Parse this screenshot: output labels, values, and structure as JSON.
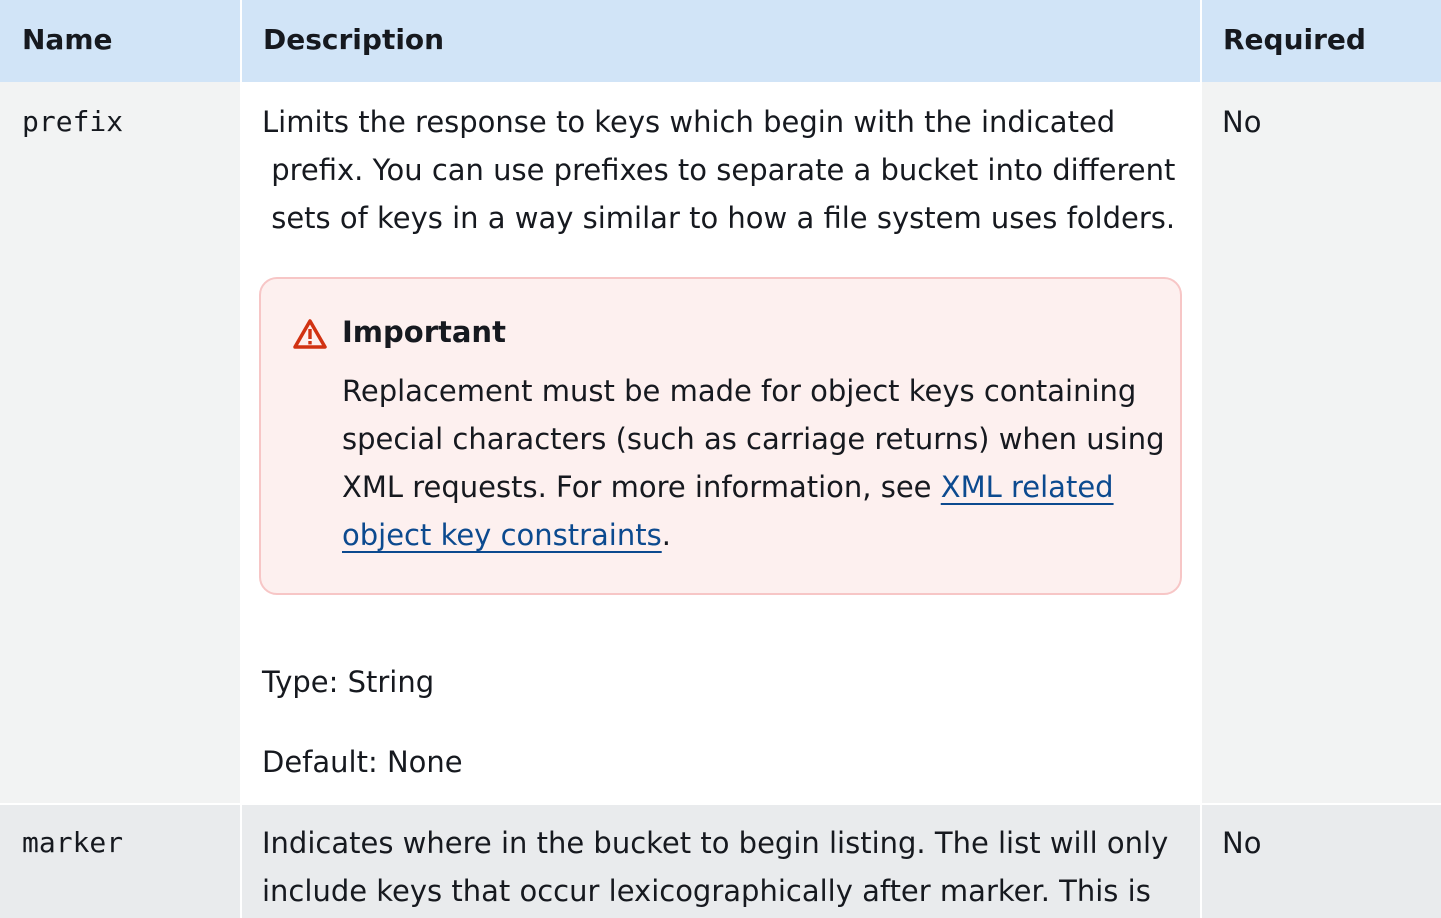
{
  "header": {
    "name": "Name",
    "description": "Description",
    "required": "Required"
  },
  "rows": [
    {
      "name": "prefix",
      "description_lines": [
        "Limits the response to keys which begin with the indicated",
        " prefix. You can use prefixes to separate a bucket into different",
        " sets of keys in a way similar to how a file system uses folders."
      ],
      "alert": {
        "title": "Important",
        "line1": "Replacement must be made for object keys containing",
        "line2": "special characters (such as carriage returns) when using",
        "line3_text": "XML requests. For more information, see ",
        "line3_link": "XML related",
        "line4_link": "object key constraints",
        "line4_after": "."
      },
      "type": "Type: String",
      "default": "Default: None",
      "required": "No"
    },
    {
      "name": "marker",
      "description_lines": [
        "Indicates where in the bucket to begin listing. The list will only",
        "include keys that occur lexicographically after marker. This is"
      ],
      "required": "No"
    }
  ],
  "colors": {
    "header_bg": "#d1e4f7",
    "alert_bg": "#fdf0ef",
    "alert_border": "#f7c6c6",
    "alert_icon": "#d13212",
    "link": "#0c4a8f"
  },
  "icons": {
    "alert": "warning-triangle-icon"
  }
}
